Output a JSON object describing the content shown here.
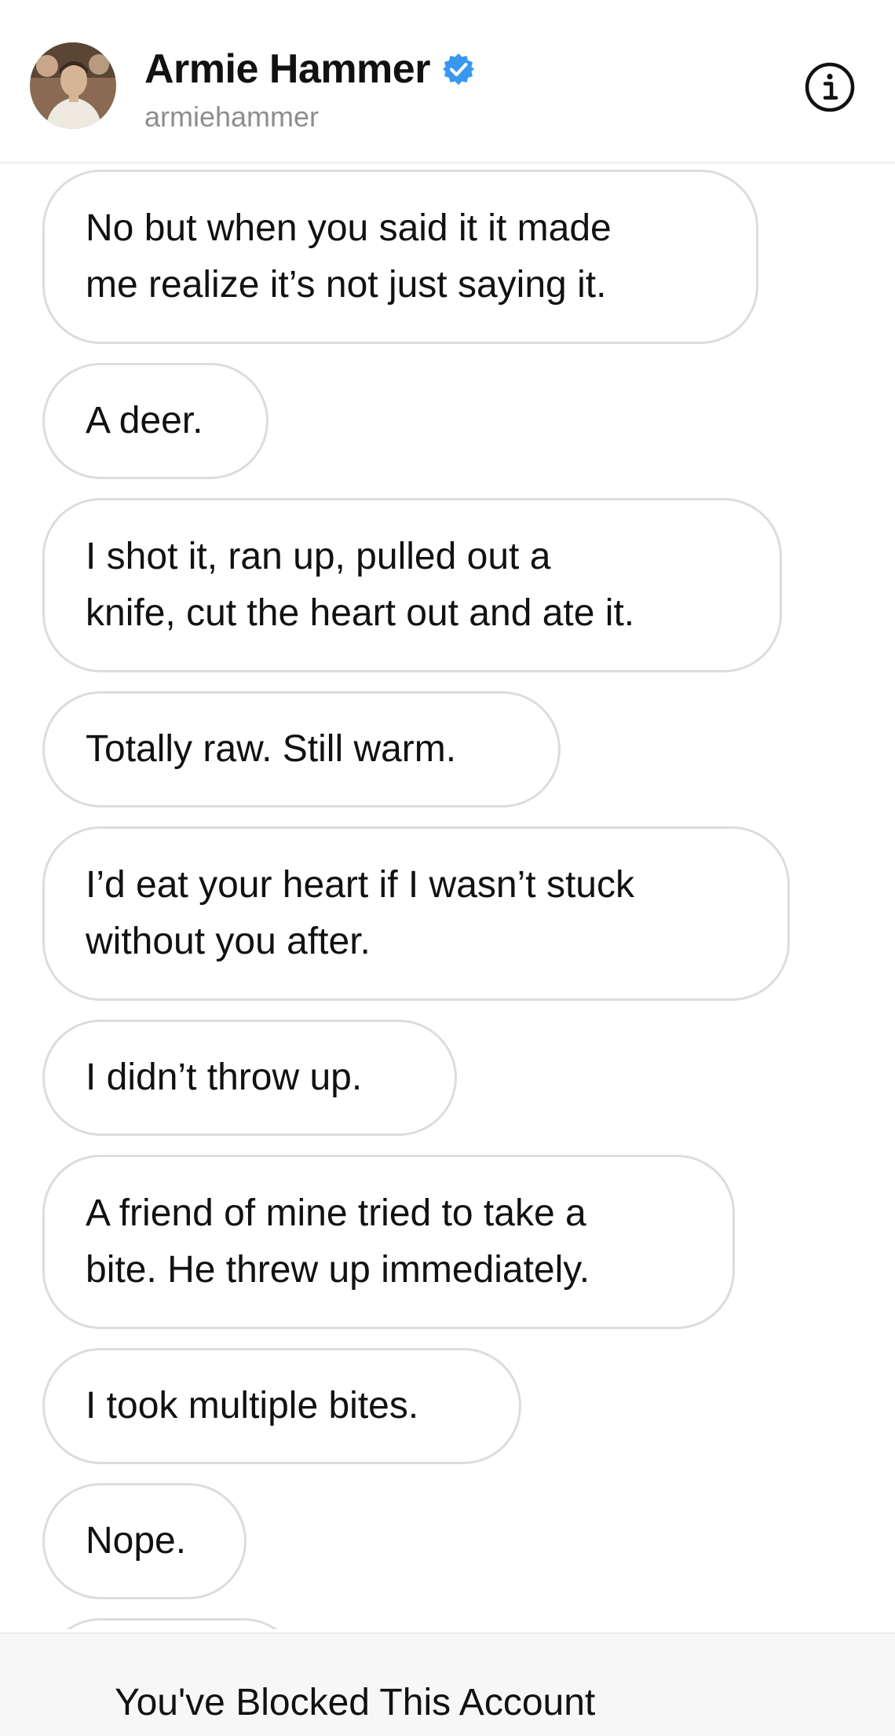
{
  "header": {
    "display_name": "Armie Hammer",
    "username": "armiehammer",
    "verified_color": "#3897f0",
    "avatar_icon": "profile-photo",
    "info_icon": "info-circle-icon"
  },
  "messages": [
    {
      "text": "No but when you said it it made\nme realize it’s not just saying it."
    },
    {
      "text": "A deer."
    },
    {
      "text": "I shot it, ran up, pulled out a\nknife, cut the heart out and ate it."
    },
    {
      "text": "Totally raw. Still warm."
    },
    {
      "text": "I’d eat your heart if I wasn’t stuck\nwithout you after."
    },
    {
      "text": "I didn’t throw up."
    },
    {
      "text": "A friend of mine tried to take a\nbite. He threw up immediately."
    },
    {
      "text": "I took multiple bites."
    },
    {
      "text": "Nope."
    },
    {
      "text": ""
    }
  ],
  "footer": {
    "blocked_text": "You've Blocked This Account"
  }
}
